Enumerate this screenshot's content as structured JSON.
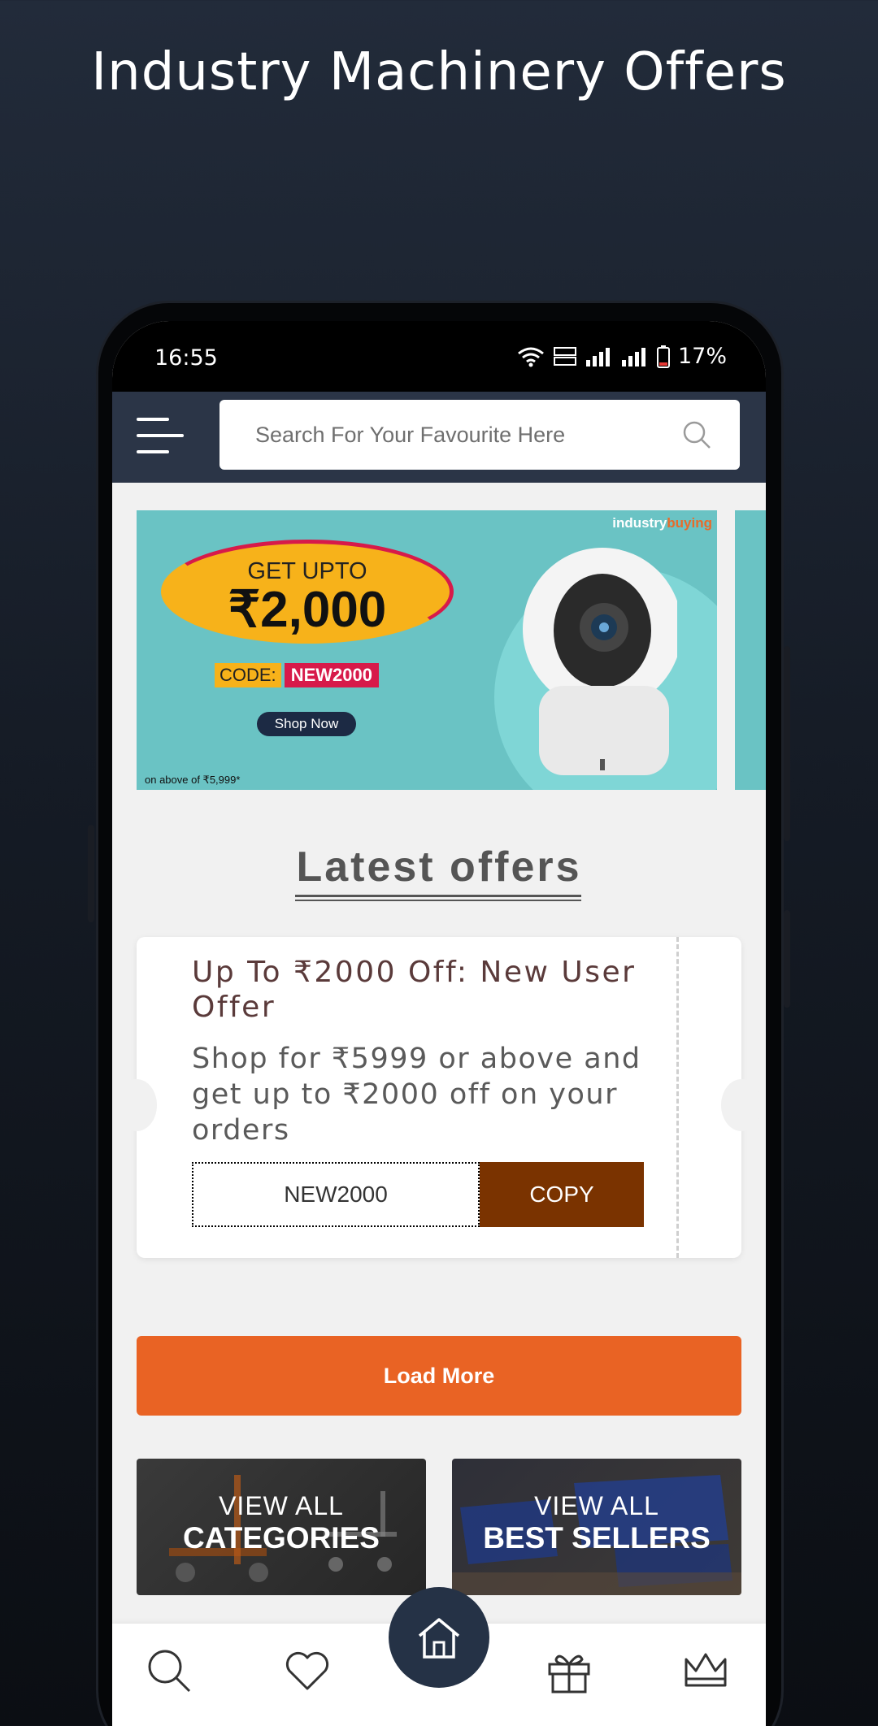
{
  "promo": {
    "title": "Industry Machinery Offers"
  },
  "status_bar": {
    "time": "16:55",
    "battery": "17%"
  },
  "header": {
    "search_placeholder": "Search For Your Favourite Here"
  },
  "banner": {
    "brand_industry": "industry",
    "brand_buying": "buying",
    "headline": "GET UPTO",
    "amount": "₹2,000",
    "code_label": "CODE:",
    "code": "NEW2000",
    "cta": "Shop Now",
    "fine_print": "on above of ₹5,999*"
  },
  "latest_offers": {
    "title": "Latest offers",
    "offer": {
      "title": "Up To ₹2000 Off: New User Offer",
      "description": "Shop for ₹5999 or above and get up to ₹2000 off on your orders",
      "code": "NEW2000",
      "copy_label": "COPY"
    },
    "load_more": "Load More"
  },
  "tiles": [
    {
      "line1": "VIEW ALL",
      "line2": "CATEGORIES"
    },
    {
      "line1": "VIEW ALL",
      "line2": "BEST SELLERS"
    }
  ],
  "bottom_nav": [
    "search-icon",
    "heart-icon",
    "home-icon",
    "gift-icon",
    "crown-icon"
  ],
  "colors": {
    "header_bg": "#2b3547",
    "accent_orange": "#e96324",
    "copy_brown": "#7a3300",
    "banner_teal": "#6ac3c4"
  }
}
